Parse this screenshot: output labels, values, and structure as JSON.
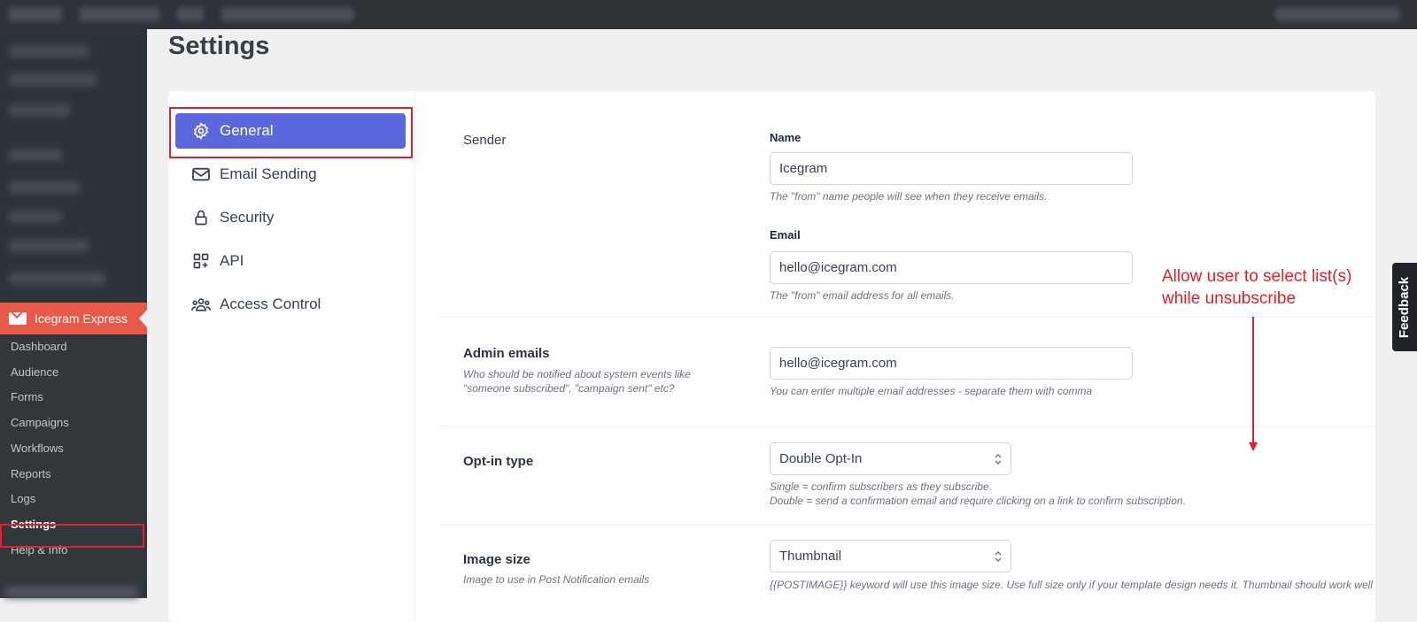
{
  "page_title": "Settings",
  "plugin_menu": {
    "title": "Icegram Express",
    "items": [
      {
        "label": "Dashboard"
      },
      {
        "label": "Audience"
      },
      {
        "label": "Forms"
      },
      {
        "label": "Campaigns"
      },
      {
        "label": "Workflows"
      },
      {
        "label": "Reports"
      },
      {
        "label": "Logs"
      },
      {
        "label": "Settings",
        "active": true
      },
      {
        "label": "Help & Info"
      }
    ]
  },
  "settings_tabs": [
    {
      "label": "General",
      "icon": "gear-icon",
      "active": true
    },
    {
      "label": "Email Sending",
      "icon": "envelope-icon"
    },
    {
      "label": "Security",
      "icon": "lock-icon"
    },
    {
      "label": "API",
      "icon": "api-grid-icon"
    },
    {
      "label": "Access Control",
      "icon": "users-icon"
    }
  ],
  "sender": {
    "label": "Sender",
    "name_label": "Name",
    "name_value": "Icegram",
    "name_help": "The \"from\" name people will see when they receive emails.",
    "email_label": "Email",
    "email_value": "hello@icegram.com",
    "email_help": "The \"from\" email address for all emails."
  },
  "admin_emails": {
    "label": "Admin emails",
    "desc_line1": "Who should be notified about system events like",
    "desc_line2": "\"someone subscribed\", \"campaign sent\" etc?",
    "value": "hello@icegram.com",
    "help": "You can enter multiple email addresses - separate them with comma"
  },
  "optin_type": {
    "label": "Opt-in type",
    "value": "Double Opt-In",
    "help_line1": "Single = confirm subscribers as they subscribe.",
    "help_line2": "Double = send a confirmation email and require clicking on a link to confirm subscription."
  },
  "image_size": {
    "label": "Image size",
    "desc": "Image to use in Post Notification emails",
    "value": "Thumbnail",
    "help": "{{POSTIMAGE}} keyword will use this image size. Use full size only if your template design needs it. Thumbnail should work well"
  },
  "annotation": {
    "line1": "Allow user to select list(s)",
    "line2": "while unsubscribe"
  },
  "feedback_label": "Feedback",
  "colors": {
    "accent": "#5b67dd",
    "brand": "#e8594a",
    "annotation": "#e0202a"
  }
}
